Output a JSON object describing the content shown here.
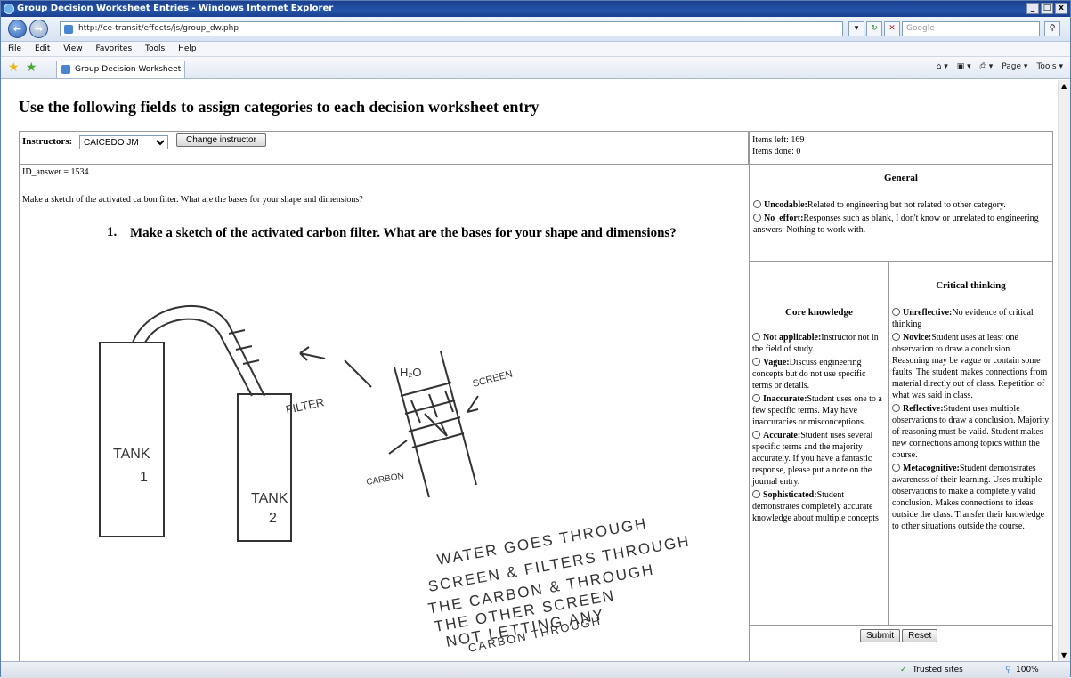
{
  "window": {
    "title": "Group Decision Worksheet Entries - Windows Internet Explorer",
    "controls": [
      "_",
      "□",
      "x"
    ]
  },
  "address_bar": {
    "url": "http://ce-transit/effects/js/group_dw.php",
    "search_placeholder": "Google"
  },
  "menu": [
    "File",
    "Edit",
    "View",
    "Favorites",
    "Tools",
    "Help"
  ],
  "tab": {
    "label": "Group Decision Worksheet Entries"
  },
  "command_bar": [
    "Page ▾",
    "Tools ▾"
  ],
  "page": {
    "heading": "Use the following fields to assign categories to each decision worksheet entry",
    "instructors_label": "Instructors:",
    "instructor_selected": "CAICEDO JM",
    "change_instructor": "Change instructor",
    "items_left": "Items left: 169",
    "items_done": "Items done: 0",
    "id_answer": "ID_answer = 1534",
    "question": "Make a sketch of the activated carbon filter. What are the bases for your shape and dimensions?",
    "question_number": "1.",
    "question_heading": "Make a sketch of the activated carbon filter. What are the bases for your shape and dimensions?"
  },
  "sketch": {
    "labels": {
      "tank1_line1": "TANK",
      "tank1_line2": "1",
      "tank2_line1": "TANK",
      "tank2_line2": "2",
      "filter": "FILTER",
      "h2o": "H₂O",
      "screen": "SCREEN",
      "carbon": "CARBON"
    },
    "handwriting": [
      "WATER GOES THROUGH",
      "SCREEN & FILTERS THROUGH",
      "THE CARBON & THROUGH",
      "THE OTHER SCREEN",
      "NOT LETTING ANY",
      "CARBON THROUGH"
    ]
  },
  "general": {
    "title": "General",
    "options": [
      {
        "name": "Uncodable:",
        "desc": "Related to engineering but not related to other category."
      },
      {
        "name": "No_effort:",
        "desc": "Responses such as blank, I don't know or unrelated to engineering answers. Nothing to work with."
      }
    ]
  },
  "core": {
    "title": "Core knowledge",
    "options": [
      {
        "name": "Not applicable:",
        "desc": "Instructor not in the field of study."
      },
      {
        "name": "Vague:",
        "desc": "Discuss engineering concepts but do not use specific terms or details."
      },
      {
        "name": "Inaccurate:",
        "desc": "Student uses one to a few specific terms. May have inaccuracies or misconceptions."
      },
      {
        "name": "Accurate:",
        "desc": "Student uses several specific terms and the majority accurately. If you have a fantastic response, please put a note on the journal entry."
      },
      {
        "name": "Sophisticated:",
        "desc": "Student demonstrates completely accurate knowledge about multiple concepts"
      }
    ]
  },
  "critical": {
    "title": "Critical thinking",
    "options": [
      {
        "name": "Unreflective:",
        "desc": "No evidence of critical thinking"
      },
      {
        "name": "Novice:",
        "desc": "Student uses at least one observation to draw a conclusion. Reasoning may be vague or contain some faults. The student makes connections from material directly out of class. Repetition of what was said in class."
      },
      {
        "name": "Reflective:",
        "desc": "Student uses multiple observations to draw a conclusion. Majority of reasoning must be valid. Student makes new connections among topics within the course."
      },
      {
        "name": "Metacognitive:",
        "desc": "Student demonstrates awareness of their learning. Uses multiple observations to make a completely valid conclusion. Makes connections to ideas outside the class. Transfer their knowledge to other situations outside the course."
      }
    ]
  },
  "form_buttons": {
    "submit": "Submit",
    "reset": "Reset"
  },
  "status": {
    "zone": "Trusted sites",
    "zoom": "100%"
  }
}
